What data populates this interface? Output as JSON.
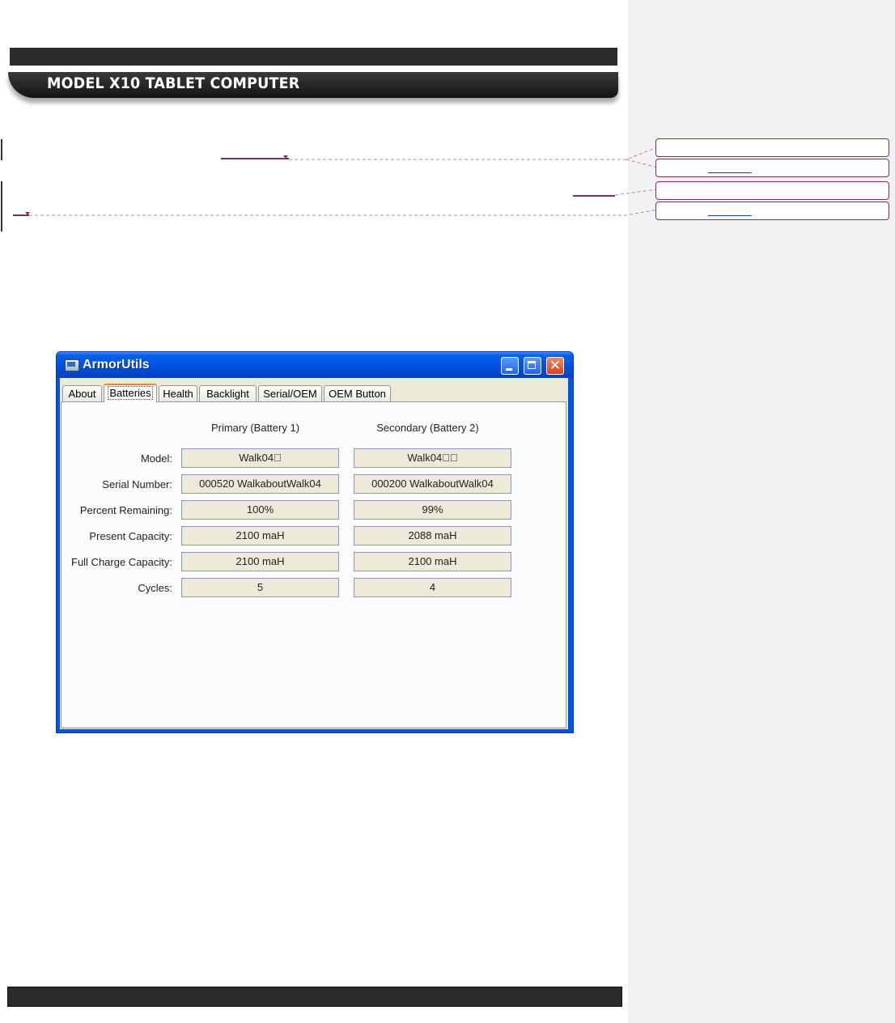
{
  "document": {
    "header_title": "MODEL X10 TABLET COMPUTER"
  },
  "window": {
    "title": "ArmorUtils",
    "controls": {
      "close_glyph": "✕"
    },
    "tabs": [
      "About",
      "Batteries",
      "Health",
      "Backlight",
      "Serial/OEM",
      "OEM Button"
    ],
    "active_tab": "Batteries"
  },
  "batteries": {
    "column_headers": [
      "Primary (Battery 1)",
      "Secondary (Battery 2)"
    ],
    "rows": [
      {
        "label": "Model:",
        "primary": "Walk04\u0000",
        "secondary": "Walk04\u0000\u0000"
      },
      {
        "label": "Serial Number:",
        "primary": "000520 WalkaboutWalk04",
        "secondary": "000200 WalkaboutWalk04"
      },
      {
        "label": "Percent Remaining:",
        "primary": "100%",
        "secondary": "99%"
      },
      {
        "label": "Present Capacity:",
        "primary": "2100 maH",
        "secondary": "2088 maH"
      },
      {
        "label": "Full Charge Capacity:",
        "primary": "2100 maH",
        "secondary": "2100 maH"
      },
      {
        "label": "Cycles:",
        "primary": "5",
        "secondary": "4"
      }
    ]
  },
  "colors": {
    "revision_mark": "#7b2d6b",
    "title_bar": "#0055e5",
    "active_tab_accent": "#e68b2c"
  }
}
